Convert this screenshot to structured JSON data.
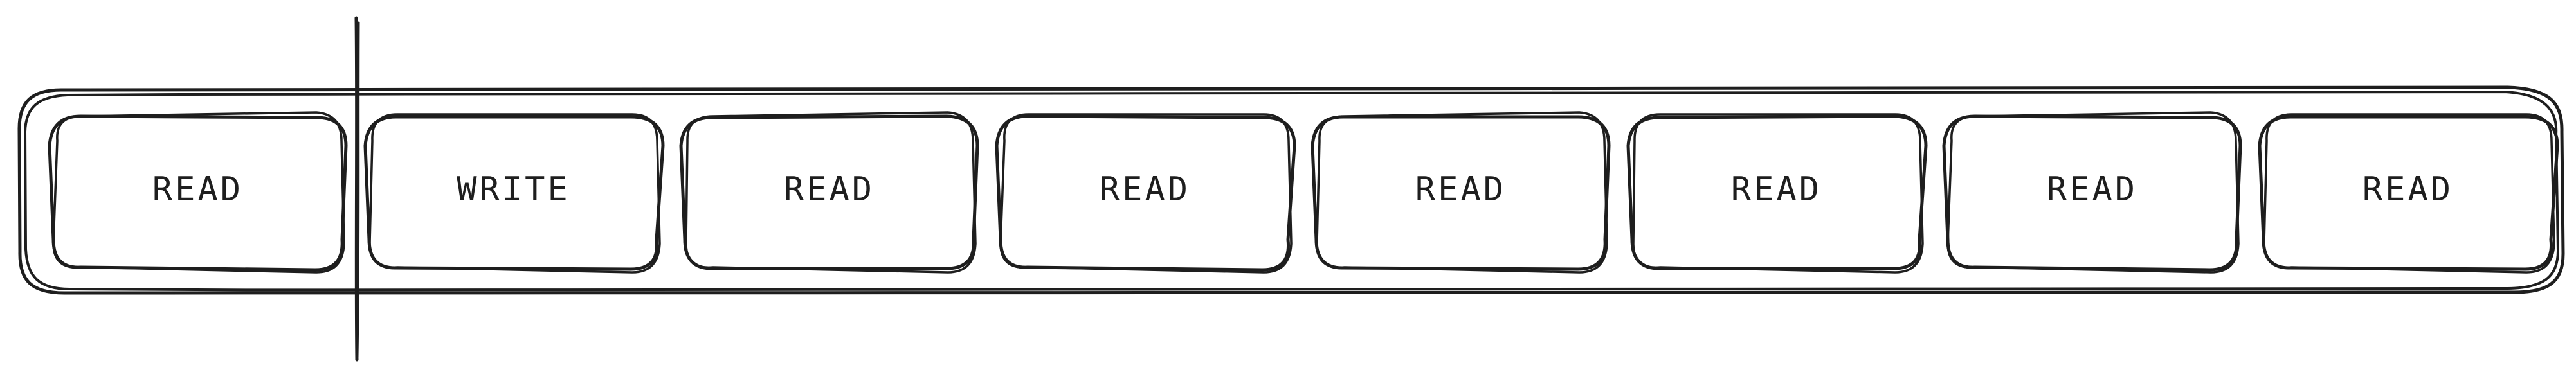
{
  "diagram": {
    "cells": [
      {
        "label": "READ"
      },
      {
        "label": "WRITE"
      },
      {
        "label": "READ"
      },
      {
        "label": "READ"
      },
      {
        "label": "READ"
      },
      {
        "label": "READ"
      },
      {
        "label": "READ"
      },
      {
        "label": "READ"
      }
    ],
    "colors": {
      "stroke": "#1e1e1e",
      "background": "#ffffff"
    }
  }
}
